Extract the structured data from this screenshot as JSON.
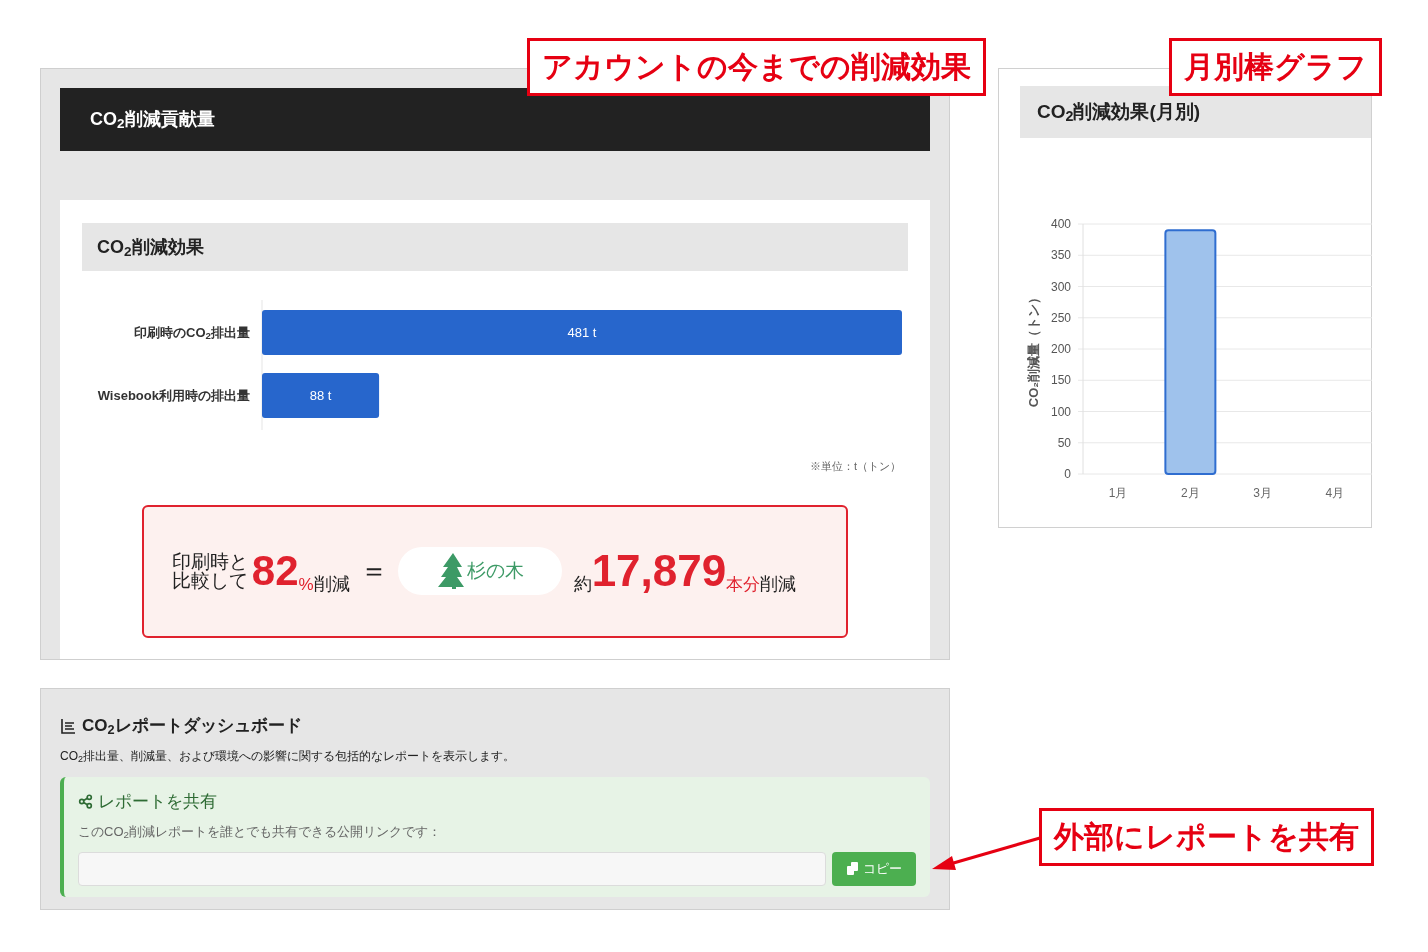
{
  "callouts": [
    {
      "text": "アカウントの今までの削減効果"
    },
    {
      "text": "月別棒グラフ"
    },
    {
      "text": "外部にレポートを共有"
    }
  ],
  "contribution_panel": {
    "title": "CO$_{2}$削減貢献量",
    "card": {
      "title": "CO$_{2}$削減効果",
      "chart_data": {
        "type": "bar",
        "orientation": "horizontal",
        "categories": [
          "印刷時のCO$_{2}$排出量",
          "Wisebook利用時の排出量"
        ],
        "values": [
          481,
          88
        ],
        "value_labels": [
          "481 t",
          "88 t"
        ],
        "data_labels": true
      },
      "unit_note": "※単位：t（トン）",
      "summary": {
        "lead": "印刷時と比較して",
        "percent": "82",
        "percent_unit": "%",
        "reduced": "削減",
        "equals": "＝",
        "tree_label": "杉の木",
        "approx": "約",
        "count": "17,879",
        "count_unit": "本分",
        "count_reduced": "削減"
      }
    }
  },
  "monthly_panel": {
    "title": "CO$_{2}$削減効果(月別)",
    "chart_data": {
      "type": "bar",
      "grid": true,
      "ylabel": "CO₂削減量（トン）",
      "categories": [
        "1月",
        "2月",
        "3月",
        "4月"
      ],
      "values": [
        null,
        390,
        null,
        null
      ],
      "ylim": [
        0,
        400
      ],
      "yticks": [
        0,
        50,
        100,
        150,
        200,
        250,
        300,
        350,
        400
      ]
    }
  },
  "report_panel": {
    "title": "CO$_{2}$レポートダッシュボード",
    "description": "CO$_{2}$排出量、削減量、および環境への影響に関する包括的なレポートを表示します。",
    "share": {
      "title": "レポートを共有",
      "text": "このCO$_{2}$削減レポートを誰とでも共有できる公開リンクです：",
      "copy_button": "コピー"
    }
  }
}
